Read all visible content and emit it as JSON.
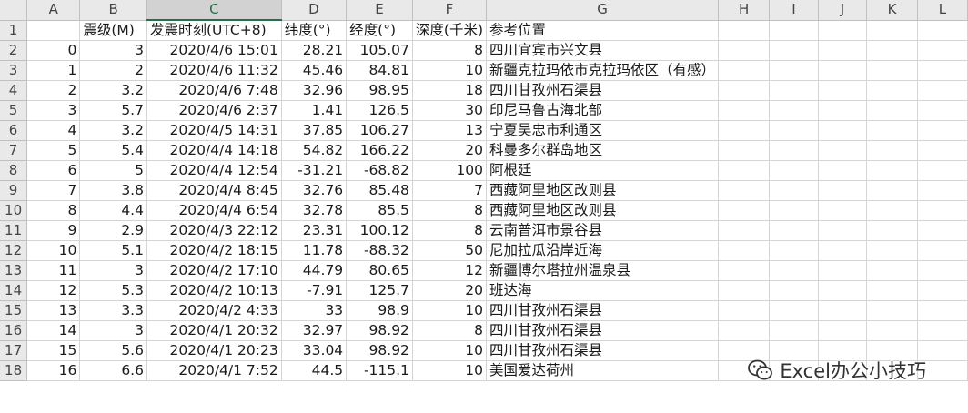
{
  "sheet": {
    "column_letters": [
      "A",
      "B",
      "C",
      "D",
      "E",
      "F",
      "G",
      "H",
      "I",
      "J",
      "K",
      "L"
    ],
    "selected_column": "C",
    "header_row": {
      "row_number": "1",
      "cells": [
        "",
        "震级(M)",
        "发震时刻(UTC+8)",
        "纬度(°)",
        "经度(°)",
        "深度(千米)",
        "参考位置",
        "",
        "",
        "",
        "",
        ""
      ]
    },
    "rows": [
      {
        "n": "2",
        "cells": [
          "0",
          "3",
          "2020/4/6 15:01",
          "28.21",
          "105.07",
          "8",
          "四川宜宾市兴文县"
        ]
      },
      {
        "n": "3",
        "cells": [
          "1",
          "2",
          "2020/4/6 11:32",
          "45.46",
          "84.81",
          "10",
          "新疆克拉玛依市克拉玛依区（有感）"
        ]
      },
      {
        "n": "4",
        "cells": [
          "2",
          "3.2",
          "2020/4/6 7:48",
          "32.96",
          "98.95",
          "18",
          "四川甘孜州石渠县"
        ]
      },
      {
        "n": "5",
        "cells": [
          "3",
          "5.7",
          "2020/4/6 2:37",
          "1.41",
          "126.5",
          "30",
          "印尼马鲁古海北部"
        ]
      },
      {
        "n": "6",
        "cells": [
          "4",
          "3.2",
          "2020/4/5 14:31",
          "37.85",
          "106.27",
          "13",
          "宁夏吴忠市利通区"
        ]
      },
      {
        "n": "7",
        "cells": [
          "5",
          "5.4",
          "2020/4/4 14:18",
          "54.82",
          "166.22",
          "20",
          "科曼多尔群岛地区"
        ]
      },
      {
        "n": "8",
        "cells": [
          "6",
          "5",
          "2020/4/4 12:54",
          "-31.21",
          "-68.82",
          "100",
          "阿根廷"
        ]
      },
      {
        "n": "9",
        "cells": [
          "7",
          "3.8",
          "2020/4/4 8:45",
          "32.76",
          "85.48",
          "7",
          "西藏阿里地区改则县"
        ]
      },
      {
        "n": "10",
        "cells": [
          "8",
          "4.4",
          "2020/4/4 6:54",
          "32.78",
          "85.5",
          "8",
          "西藏阿里地区改则县"
        ]
      },
      {
        "n": "11",
        "cells": [
          "9",
          "2.9",
          "2020/4/3 22:12",
          "23.31",
          "100.12",
          "8",
          "云南普洱市景谷县"
        ]
      },
      {
        "n": "12",
        "cells": [
          "10",
          "5.1",
          "2020/4/2 18:15",
          "11.78",
          "-88.32",
          "50",
          "尼加拉瓜沿岸近海"
        ]
      },
      {
        "n": "13",
        "cells": [
          "11",
          "3",
          "2020/4/2 17:10",
          "44.79",
          "80.65",
          "12",
          "新疆博尔塔拉州温泉县"
        ]
      },
      {
        "n": "14",
        "cells": [
          "12",
          "5.3",
          "2020/4/2 10:13",
          "-7.91",
          "125.7",
          "20",
          "班达海"
        ]
      },
      {
        "n": "15",
        "cells": [
          "13",
          "3.3",
          "2020/4/2 4:33",
          "33",
          "98.9",
          "10",
          "四川甘孜州石渠县"
        ]
      },
      {
        "n": "16",
        "cells": [
          "14",
          "3",
          "2020/4/1 20:32",
          "32.97",
          "98.92",
          "8",
          "四川甘孜州石渠县"
        ]
      },
      {
        "n": "17",
        "cells": [
          "15",
          "5.6",
          "2020/4/1 20:23",
          "33.04",
          "98.92",
          "10",
          "四川甘孜州石渠县"
        ]
      },
      {
        "n": "18",
        "cells": [
          "16",
          "6.6",
          "2020/4/1 7:52",
          "44.5",
          "-115.1",
          "10",
          "美国爱达荷州"
        ]
      }
    ]
  },
  "watermark": {
    "text": "Excel办公小技巧",
    "icon": "wechat-icon"
  }
}
